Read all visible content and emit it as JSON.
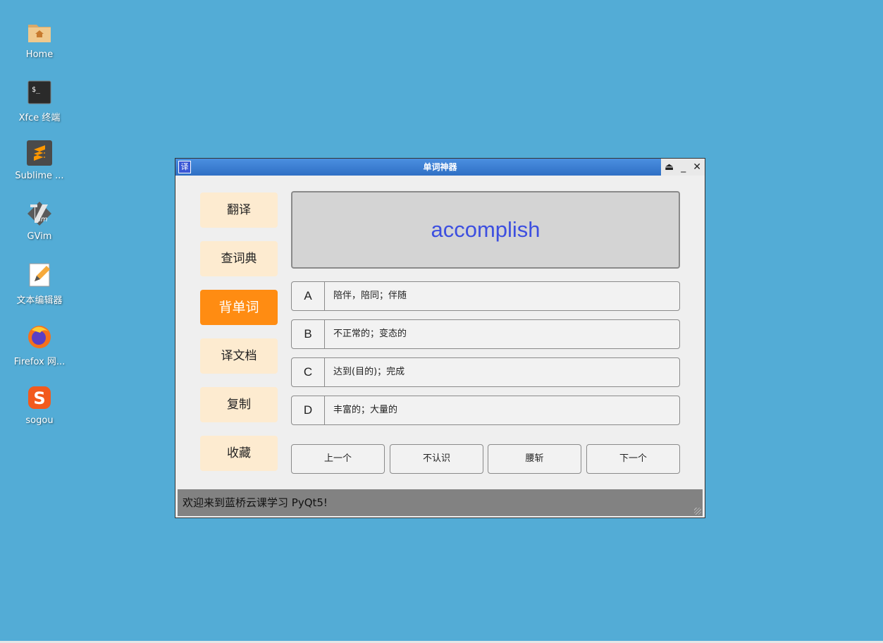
{
  "desktop": {
    "icons": [
      {
        "label": "Home",
        "icon": "home-folder-icon"
      },
      {
        "label": "Xfce 终端",
        "icon": "terminal-icon"
      },
      {
        "label": "Sublime ...",
        "icon": "sublime-text-icon"
      },
      {
        "label": "GVim",
        "icon": "vim-icon"
      },
      {
        "label": "文本编辑器",
        "icon": "text-editor-icon"
      },
      {
        "label": "Firefox 网...",
        "icon": "firefox-icon"
      },
      {
        "label": "sogou",
        "icon": "sogou-icon"
      }
    ]
  },
  "window": {
    "title": "单词神器",
    "app_icon_text": "译",
    "controls": {
      "shade": "⏏",
      "minimize": "_",
      "close": "✕"
    }
  },
  "sidebar": {
    "items": [
      {
        "label": "翻译",
        "active": false
      },
      {
        "label": "查词典",
        "active": false
      },
      {
        "label": "背单词",
        "active": true
      },
      {
        "label": "译文档",
        "active": false
      },
      {
        "label": "复制",
        "active": false
      },
      {
        "label": "收藏",
        "active": false
      }
    ]
  },
  "quiz": {
    "word": "accomplish",
    "options": [
      {
        "letter": "A",
        "meaning": "陪伴，陪同；伴随"
      },
      {
        "letter": "B",
        "meaning": "不正常的；变态的"
      },
      {
        "letter": "C",
        "meaning": "达到(目的)；完成"
      },
      {
        "letter": "D",
        "meaning": "丰富的；大量的"
      }
    ],
    "actions": {
      "prev": "上一个",
      "unknown": "不认识",
      "chop": "腰斩",
      "next": "下一个"
    }
  },
  "status": {
    "message": "欢迎来到蓝桥云课学习 PyQt5!"
  },
  "colors": {
    "desktop_bg": "#53acd6",
    "active_button": "#ff8c12",
    "inactive_button": "#fdebd0",
    "word_color": "#3d4fe0"
  }
}
